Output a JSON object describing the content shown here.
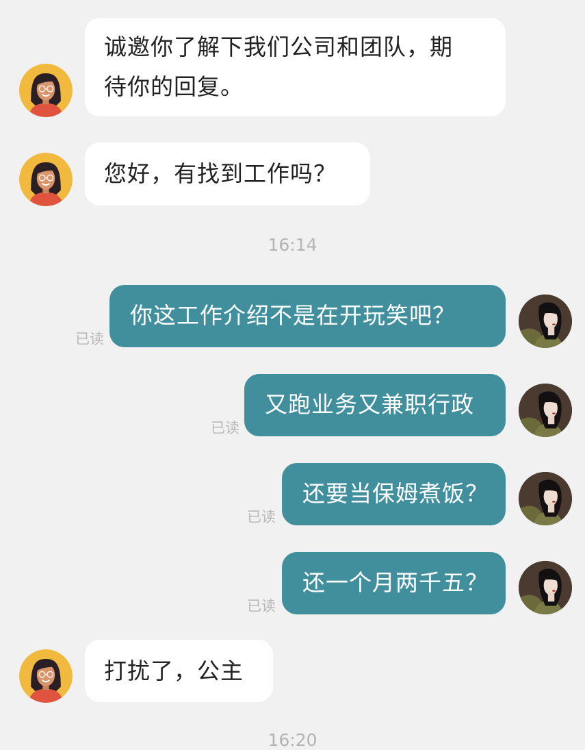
{
  "messages": {
    "m1": {
      "line1": "诚邀你了解下我们公司和团队，期",
      "line2": "待你的回复。"
    },
    "m2": "您好，有找到工作吗？",
    "m3": "你这工作介绍不是在开玩笑吧？",
    "m4": "又跑业务又兼职行政",
    "m5": "还要当保姆煮饭？",
    "m6": "还一个月两千五？",
    "m7": "打扰了，公主"
  },
  "read_receipt": "已读",
  "timestamps": {
    "t1": "16:14",
    "t2": "16:20"
  },
  "colors": {
    "background": "#f1f1f1",
    "incoming_bubble": "#ffffff",
    "outgoing_bubble": "#418f9d",
    "read_text": "#b8b8b8"
  },
  "icons": {
    "recruiter_avatar": "cartoon-woman-with-glasses-avatar",
    "user_avatar": "woman-portrait-photo-avatar"
  }
}
